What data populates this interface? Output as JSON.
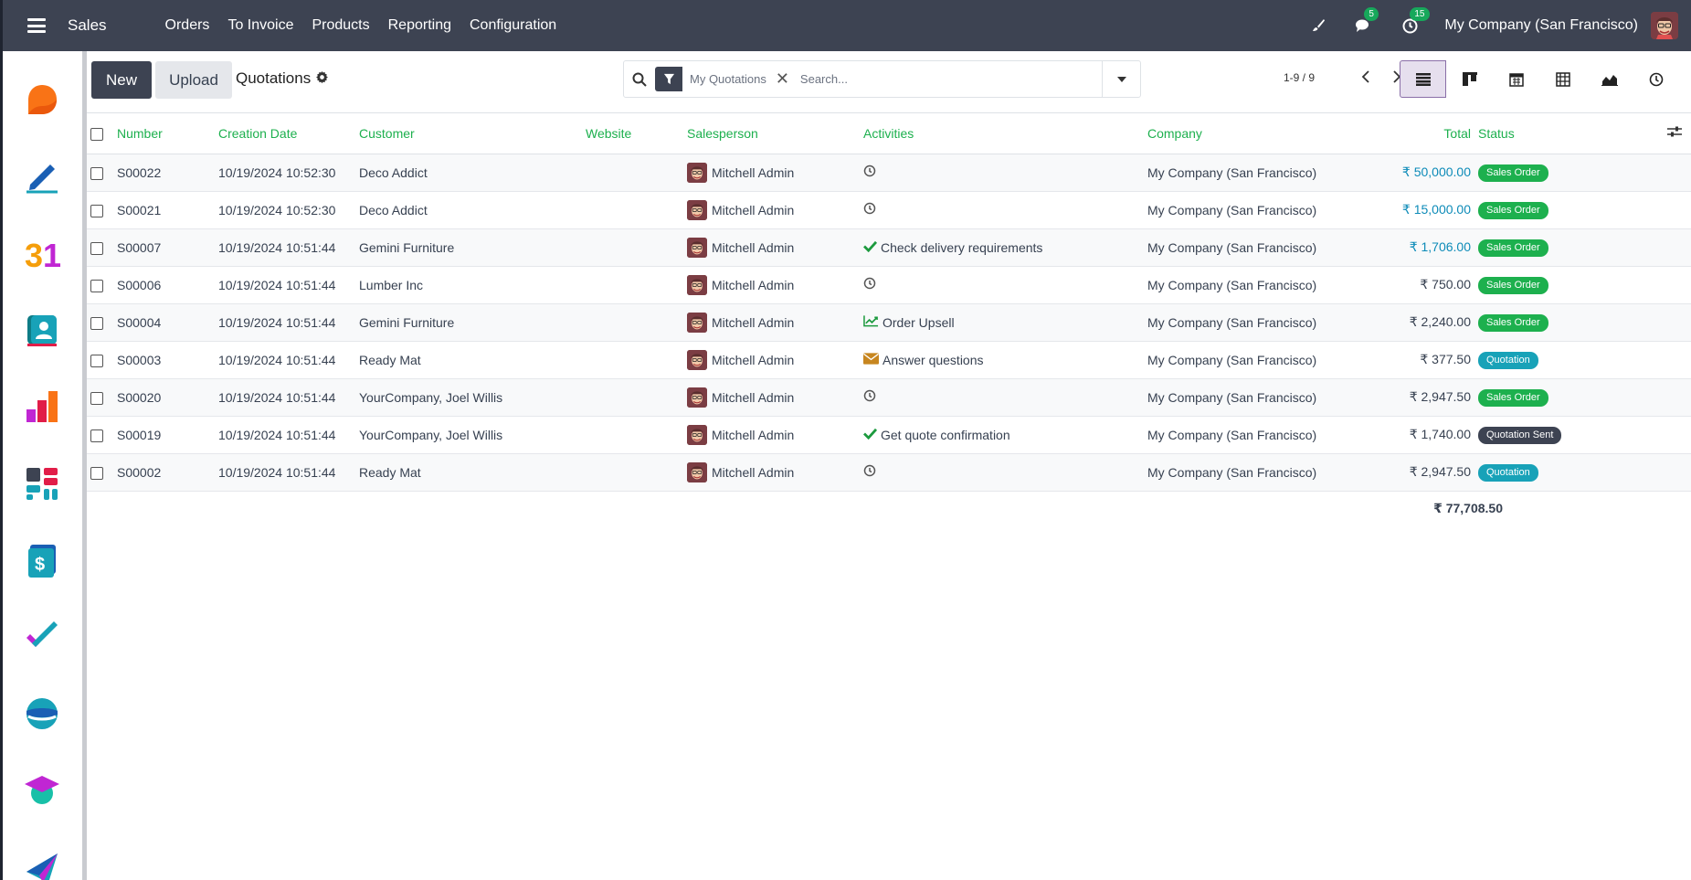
{
  "navbar": {
    "brand": "Sales",
    "menu": [
      "Orders",
      "To Invoice",
      "Products",
      "Reporting",
      "Configuration"
    ],
    "messages_count": "5",
    "activities_count": "15",
    "company": "My Company (San Francisco)"
  },
  "control": {
    "new_label": "New",
    "upload_label": "Upload",
    "breadcrumb": "Quotations",
    "facet": "My Quotations",
    "search_placeholder": "Search...",
    "pager": "1-9 / 9"
  },
  "table": {
    "headers": {
      "number": "Number",
      "date": "Creation Date",
      "customer": "Customer",
      "website": "Website",
      "salesperson": "Salesperson",
      "activities": "Activities",
      "company": "Company",
      "total": "Total",
      "status": "Status"
    },
    "rows": [
      {
        "number": "S00022",
        "date": "10/19/2024 10:52:30",
        "customer": "Deco Addict",
        "salesperson": "Mitchell Admin",
        "activity": "",
        "activity_icon": "clock-icon",
        "company": "My Company (San Francisco)",
        "total": "₹ 50,000.00",
        "total_blue": true,
        "status": "Sales Order",
        "status_color": "green"
      },
      {
        "number": "S00021",
        "date": "10/19/2024 10:52:30",
        "customer": "Deco Addict",
        "salesperson": "Mitchell Admin",
        "activity": "",
        "activity_icon": "clock-icon",
        "company": "My Company (San Francisco)",
        "total": "₹ 15,000.00",
        "total_blue": true,
        "status": "Sales Order",
        "status_color": "green"
      },
      {
        "number": "S00007",
        "date": "10/19/2024 10:51:44",
        "customer": "Gemini Furniture",
        "salesperson": "Mitchell Admin",
        "activity": "Check delivery requirements",
        "activity_icon": "check-icon",
        "company": "My Company (San Francisco)",
        "total": "₹ 1,706.00",
        "total_blue": true,
        "status": "Sales Order",
        "status_color": "green"
      },
      {
        "number": "S00006",
        "date": "10/19/2024 10:51:44",
        "customer": "Lumber Inc",
        "salesperson": "Mitchell Admin",
        "activity": "",
        "activity_icon": "clock-icon",
        "company": "My Company (San Francisco)",
        "total": "₹ 750.00",
        "total_blue": false,
        "status": "Sales Order",
        "status_color": "green"
      },
      {
        "number": "S00004",
        "date": "10/19/2024 10:51:44",
        "customer": "Gemini Furniture",
        "salesperson": "Mitchell Admin",
        "activity": "Order Upsell",
        "activity_icon": "chart-icon",
        "company": "My Company (San Francisco)",
        "total": "₹ 2,240.00",
        "total_blue": false,
        "status": "Sales Order",
        "status_color": "green"
      },
      {
        "number": "S00003",
        "date": "10/19/2024 10:51:44",
        "customer": "Ready Mat",
        "salesperson": "Mitchell Admin",
        "activity": "Answer questions",
        "activity_icon": "envelope-icon",
        "company": "My Company (San Francisco)",
        "total": "₹ 377.50",
        "total_blue": false,
        "status": "Quotation",
        "status_color": "teal"
      },
      {
        "number": "S00020",
        "date": "10/19/2024 10:51:44",
        "customer": "YourCompany, Joel Willis",
        "salesperson": "Mitchell Admin",
        "activity": "",
        "activity_icon": "clock-icon",
        "company": "My Company (San Francisco)",
        "total": "₹ 2,947.50",
        "total_blue": false,
        "status": "Sales Order",
        "status_color": "green"
      },
      {
        "number": "S00019",
        "date": "10/19/2024 10:51:44",
        "customer": "YourCompany, Joel Willis",
        "salesperson": "Mitchell Admin",
        "activity": "Get quote confirmation",
        "activity_icon": "check-icon",
        "company": "My Company (San Francisco)",
        "total": "₹ 1,740.00",
        "total_blue": false,
        "status": "Quotation Sent",
        "status_color": "dark"
      },
      {
        "number": "S00002",
        "date": "10/19/2024 10:51:44",
        "customer": "Ready Mat",
        "salesperson": "Mitchell Admin",
        "activity": "",
        "activity_icon": "clock-icon",
        "company": "My Company (San Francisco)",
        "total": "₹ 2,947.50",
        "total_blue": false,
        "status": "Quotation",
        "status_color": "teal"
      }
    ],
    "grand_total": "₹ 77,708.50"
  },
  "apps": [
    "crm-icon",
    "sign-icon",
    "calendar-icon",
    "contacts-icon",
    "dashboards-icon",
    "apps-icon",
    "invoicing-icon",
    "project-icon",
    "discuss-icon",
    "elearning-icon",
    "email-marketing-icon"
  ],
  "colors": {
    "accent": "#3d4352",
    "header_text": "#1db04e",
    "badge_green": "#1db04e",
    "badge_teal": "#18a2b8",
    "badge_dark": "#3d4352",
    "link_blue": "#0d8bb8"
  }
}
